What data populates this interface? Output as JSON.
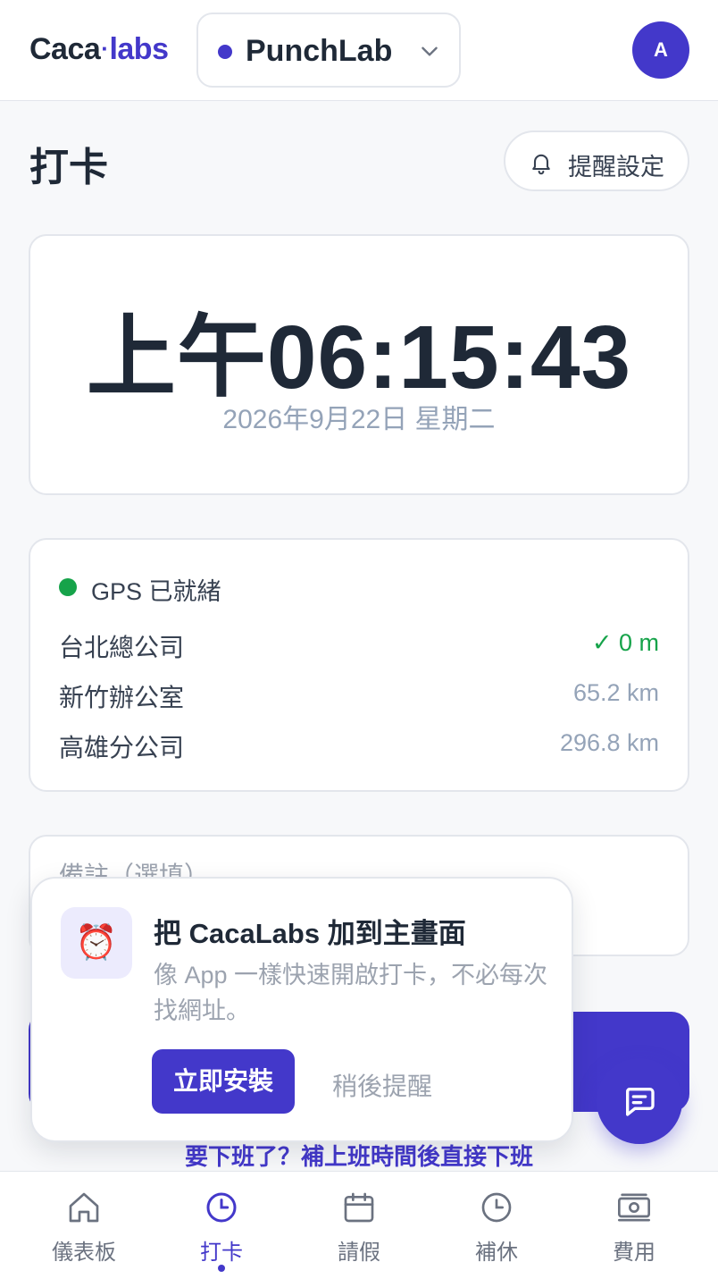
{
  "header": {
    "logo_part1": "Caca",
    "logo_dot": "·",
    "logo_part2": "labs",
    "project_name": "PunchLab",
    "avatar_initial": "A"
  },
  "page": {
    "title": "打卡",
    "reminder_label": "提醒設定"
  },
  "clock": {
    "time": "上午06:15:43",
    "date": "2026年9月22日 星期二"
  },
  "gps": {
    "status": "GPS 已就緒",
    "locations": [
      {
        "name": "台北總公司",
        "distance": "✓ 0 m",
        "in_range": true
      },
      {
        "name": "新竹辦公室",
        "distance": "65.2 km",
        "in_range": false
      },
      {
        "name": "高雄分公司",
        "distance": "296.8 km",
        "in_range": false
      }
    ]
  },
  "note": {
    "placeholder": "備註（選填）"
  },
  "leave_link": "要下班了？補上班時間後直接下班",
  "install_prompt": {
    "icon": "alarm-clock-icon",
    "emoji": "⏰",
    "title": "把 CacaLabs 加到主畫面",
    "description": "像 App 一樣快速開啟打卡，不必每次找網址。",
    "install_label": "立即安裝",
    "later_label": "稍後提醒"
  },
  "nav": {
    "items": [
      {
        "label": "儀表板",
        "icon": "home-icon"
      },
      {
        "label": "打卡",
        "icon": "clock-icon",
        "active": true
      },
      {
        "label": "請假",
        "icon": "calendar-icon"
      },
      {
        "label": "補休",
        "icon": "clock-icon"
      },
      {
        "label": "費用",
        "icon": "cash-icon"
      }
    ]
  },
  "colors": {
    "accent": "#4338ca",
    "success": "#16a34a",
    "muted": "#94a3b8"
  }
}
